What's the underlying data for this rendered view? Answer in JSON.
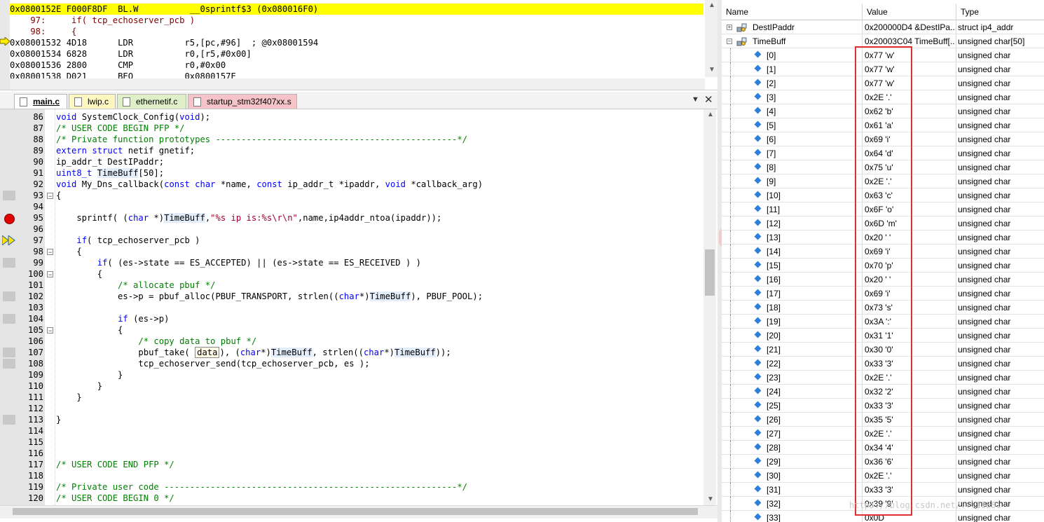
{
  "disassembly": {
    "lines": [
      {
        "text": "0x0800152E F000F8DF  BL.W          __0sprintf$3 (0x080016F0)",
        "kind": "highlight"
      },
      {
        "text": "    97:     if( tcp_echoserver_pcb )",
        "kind": "source"
      },
      {
        "text": "    98:     {",
        "kind": "source"
      },
      {
        "text": "0x08001532 4D18      LDR          r5,[pc,#96]  ; @0x08001594",
        "kind": "current"
      },
      {
        "text": "0x08001534 6828      LDR          r0,[r5,#0x00]",
        "kind": "asm"
      },
      {
        "text": "0x08001536 2800      CMP          r0,#0x00",
        "kind": "asm"
      },
      {
        "text": "0x08001538 D021      BEQ          0x0800157E",
        "kind": "asm"
      }
    ]
  },
  "tabs": [
    {
      "label": "main.c",
      "color": "#ffffff",
      "active": true
    },
    {
      "label": "lwip.c",
      "color": "#fff7c0",
      "active": false
    },
    {
      "label": "ethernetif.c",
      "color": "#dff0c8",
      "active": false
    },
    {
      "label": "startup_stm32f407xx.s",
      "color": "#f6c4c8",
      "active": false
    }
  ],
  "code": {
    "lines": [
      {
        "n": "86",
        "t": "void SystemClock_Config(void);"
      },
      {
        "n": "87",
        "t": "/* USER CODE BEGIN PFP */"
      },
      {
        "n": "88",
        "t": "/* Private function prototypes -----------------------------------------------*/"
      },
      {
        "n": "89",
        "t": "extern struct netif gnetif;"
      },
      {
        "n": "90",
        "t": "ip_addr_t DestIPaddr;"
      },
      {
        "n": "91",
        "t": "uint8_t TimeBuff[50];"
      },
      {
        "n": "92",
        "t": "void My_Dns_callback(const char *name, const ip_addr_t *ipaddr, void *callback_arg)"
      },
      {
        "n": "93",
        "t": "{"
      },
      {
        "n": "94",
        "t": ""
      },
      {
        "n": "95",
        "t": "    sprintf( (char *)TimeBuff,\"%s ip is:%s\\r\\n\",name,ip4addr_ntoa(ipaddr));"
      },
      {
        "n": "96",
        "t": ""
      },
      {
        "n": "97",
        "t": "    if( tcp_echoserver_pcb )"
      },
      {
        "n": "98",
        "t": "    {"
      },
      {
        "n": "99",
        "t": "        if( (es->state == ES_ACCEPTED) || (es->state == ES_RECEIVED ) )"
      },
      {
        "n": "100",
        "t": "        {"
      },
      {
        "n": "101",
        "t": "            /* allocate pbuf */"
      },
      {
        "n": "102",
        "t": "            es->p = pbuf_alloc(PBUF_TRANSPORT, strlen((char*)TimeBuff), PBUF_POOL);"
      },
      {
        "n": "103",
        "t": ""
      },
      {
        "n": "104",
        "t": "            if (es->p)"
      },
      {
        "n": "105",
        "t": "            {"
      },
      {
        "n": "106",
        "t": "                /* copy data to pbuf */"
      },
      {
        "n": "107",
        "t": "                pbuf_take( data), (char*)TimeBuff, strlen((char*)TimeBuff));"
      },
      {
        "n": "108",
        "t": "                tcp_echoserver_send(tcp_echoserver_pcb, es );"
      },
      {
        "n": "109",
        "t": "            }"
      },
      {
        "n": "110",
        "t": "        }"
      },
      {
        "n": "111",
        "t": "    }"
      },
      {
        "n": "112",
        "t": ""
      },
      {
        "n": "113",
        "t": "}"
      },
      {
        "n": "114",
        "t": ""
      },
      {
        "n": "115",
        "t": ""
      },
      {
        "n": "116",
        "t": ""
      },
      {
        "n": "117",
        "t": "/* USER CODE END PFP */"
      },
      {
        "n": "118",
        "t": ""
      },
      {
        "n": "119",
        "t": "/* Private user code ---------------------------------------------------------*/"
      },
      {
        "n": "120",
        "t": "/* USER CODE BEGIN 0 */"
      }
    ],
    "breakpoint_line": "95",
    "current_line": "97",
    "hover_token": "data"
  },
  "watch": {
    "headers": {
      "name": "Name",
      "value": "Value",
      "type": "Type"
    },
    "rows": [
      {
        "name": "DestIPaddr",
        "value": "0x200000D4 &DestIPa...",
        "type": "struct ip4_addr",
        "level": 0,
        "expander": "+"
      },
      {
        "name": "TimeBuff",
        "value": "0x20003C04 TimeBuff[...",
        "type": "unsigned char[50]",
        "level": 0,
        "expander": "-"
      },
      {
        "name": "[0]",
        "value": "0x77 'w'",
        "type": "unsigned char",
        "level": 1
      },
      {
        "name": "[1]",
        "value": "0x77 'w'",
        "type": "unsigned char",
        "level": 1
      },
      {
        "name": "[2]",
        "value": "0x77 'w'",
        "type": "unsigned char",
        "level": 1
      },
      {
        "name": "[3]",
        "value": "0x2E '.'",
        "type": "unsigned char",
        "level": 1
      },
      {
        "name": "[4]",
        "value": "0x62 'b'",
        "type": "unsigned char",
        "level": 1
      },
      {
        "name": "[5]",
        "value": "0x61 'a'",
        "type": "unsigned char",
        "level": 1
      },
      {
        "name": "[6]",
        "value": "0x69 'i'",
        "type": "unsigned char",
        "level": 1
      },
      {
        "name": "[7]",
        "value": "0x64 'd'",
        "type": "unsigned char",
        "level": 1
      },
      {
        "name": "[8]",
        "value": "0x75 'u'",
        "type": "unsigned char",
        "level": 1
      },
      {
        "name": "[9]",
        "value": "0x2E '.'",
        "type": "unsigned char",
        "level": 1
      },
      {
        "name": "[10]",
        "value": "0x63 'c'",
        "type": "unsigned char",
        "level": 1
      },
      {
        "name": "[11]",
        "value": "0x6F 'o'",
        "type": "unsigned char",
        "level": 1
      },
      {
        "name": "[12]",
        "value": "0x6D 'm'",
        "type": "unsigned char",
        "level": 1
      },
      {
        "name": "[13]",
        "value": "0x20 ' '",
        "type": "unsigned char",
        "level": 1
      },
      {
        "name": "[14]",
        "value": "0x69 'i'",
        "type": "unsigned char",
        "level": 1
      },
      {
        "name": "[15]",
        "value": "0x70 'p'",
        "type": "unsigned char",
        "level": 1
      },
      {
        "name": "[16]",
        "value": "0x20 ' '",
        "type": "unsigned char",
        "level": 1
      },
      {
        "name": "[17]",
        "value": "0x69 'i'",
        "type": "unsigned char",
        "level": 1
      },
      {
        "name": "[18]",
        "value": "0x73 's'",
        "type": "unsigned char",
        "level": 1
      },
      {
        "name": "[19]",
        "value": "0x3A ':'",
        "type": "unsigned char",
        "level": 1
      },
      {
        "name": "[20]",
        "value": "0x31 '1'",
        "type": "unsigned char",
        "level": 1
      },
      {
        "name": "[21]",
        "value": "0x30 '0'",
        "type": "unsigned char",
        "level": 1
      },
      {
        "name": "[22]",
        "value": "0x33 '3'",
        "type": "unsigned char",
        "level": 1
      },
      {
        "name": "[23]",
        "value": "0x2E '.'",
        "type": "unsigned char",
        "level": 1
      },
      {
        "name": "[24]",
        "value": "0x32 '2'",
        "type": "unsigned char",
        "level": 1
      },
      {
        "name": "[25]",
        "value": "0x33 '3'",
        "type": "unsigned char",
        "level": 1
      },
      {
        "name": "[26]",
        "value": "0x35 '5'",
        "type": "unsigned char",
        "level": 1
      },
      {
        "name": "[27]",
        "value": "0x2E '.'",
        "type": "unsigned char",
        "level": 1
      },
      {
        "name": "[28]",
        "value": "0x34 '4'",
        "type": "unsigned char",
        "level": 1
      },
      {
        "name": "[29]",
        "value": "0x36 '6'",
        "type": "unsigned char",
        "level": 1
      },
      {
        "name": "[30]",
        "value": "0x2E '.'",
        "type": "unsigned char",
        "level": 1
      },
      {
        "name": "[31]",
        "value": "0x33 '3'",
        "type": "unsigned char",
        "level": 1
      },
      {
        "name": "[32]",
        "value": "0x39 '9'",
        "type": "unsigned char",
        "level": 1
      },
      {
        "name": "[33]",
        "value": "0x0D",
        "type": "unsigned char",
        "level": 1
      }
    ]
  },
  "watermark": "https://blog.csdn.net/...11881",
  "colors": {
    "highlight": "#ffff00",
    "keyword": "#0000ff",
    "comment": "#008000",
    "string": "#a0002b",
    "source_line": "#800000",
    "annotation_box": "#e03030"
  }
}
